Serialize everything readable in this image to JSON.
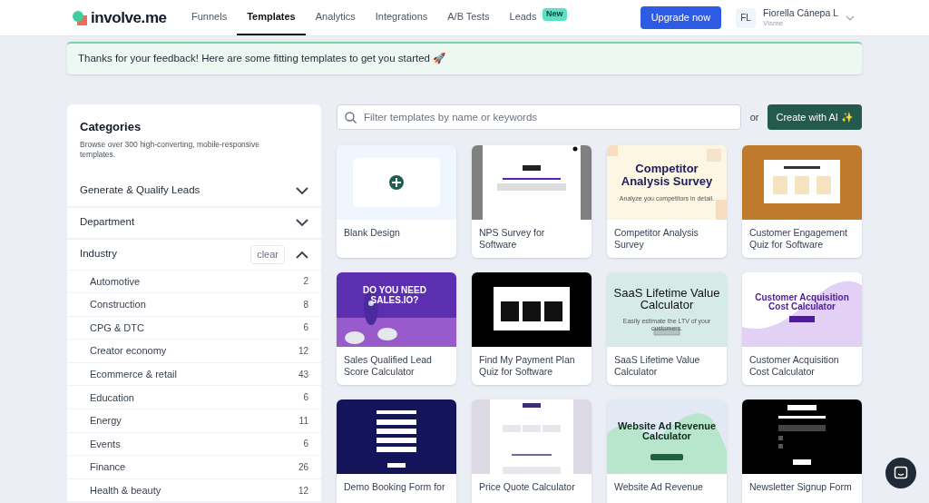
{
  "brand": "involve.me",
  "nav": [
    {
      "label": "Funnels",
      "selected": false
    },
    {
      "label": "Templates",
      "selected": true
    },
    {
      "label": "Analytics",
      "selected": false
    },
    {
      "label": "Integrations",
      "selected": false
    },
    {
      "label": "A/B Tests",
      "selected": false
    },
    {
      "label": "Leads",
      "selected": false,
      "badge": "New"
    }
  ],
  "upgrade_button": "Upgrade now",
  "user": {
    "initials": "FL",
    "name": "Fiorella Cánepa L",
    "org": "Visme"
  },
  "banner": "Thanks for your feedback! Here are some fitting templates to get you started 🚀",
  "sidebar": {
    "title": "Categories",
    "subtitle": "Browse over 300 high-converting, mobile-responsive templates.",
    "sections": [
      {
        "label": "Generate & Qualify Leads",
        "expanded": false
      },
      {
        "label": "Department",
        "expanded": false
      },
      {
        "label": "Industry",
        "expanded": true,
        "clear": "clear",
        "items": [
          {
            "label": "Automotive",
            "count": "2"
          },
          {
            "label": "Construction",
            "count": "8"
          },
          {
            "label": "CPG & DTC",
            "count": "6"
          },
          {
            "label": "Creator economy",
            "count": "12"
          },
          {
            "label": "Ecommerce & retail",
            "count": "43"
          },
          {
            "label": "Education",
            "count": "6"
          },
          {
            "label": "Energy",
            "count": "11"
          },
          {
            "label": "Events",
            "count": "6"
          },
          {
            "label": "Finance",
            "count": "26"
          },
          {
            "label": "Health & beauty",
            "count": "12"
          }
        ]
      }
    ]
  },
  "search": {
    "placeholder": "Filter templates by name or keywords"
  },
  "or": "or",
  "ai_button": "Create with AI ✨",
  "templates": [
    {
      "title": "Blank Design",
      "kind": "blank"
    },
    {
      "title": "NPS Survey for Software",
      "kind": "nps"
    },
    {
      "title": "Competitor Analysis Survey",
      "kind": "competitor",
      "heading": "Competitor Analysis Survey",
      "sub": "Analyze you competitors in detail."
    },
    {
      "title": "Customer Engagement Quiz for Software",
      "kind": "quiz"
    },
    {
      "title": "Sales Qualified Lead Score Calculator",
      "kind": "rocket",
      "heading": "DO YOU NEED SALES.IO?"
    },
    {
      "title": "Find My Payment Plan Quiz for Software",
      "kind": "payment"
    },
    {
      "title": "SaaS Lifetime Value Calculator",
      "kind": "saas",
      "heading": "SaaS Lifetime Value Calculator",
      "sub": "Easily estimate the LTV of your customers."
    },
    {
      "title": "Customer Acquisition Cost Calculator",
      "kind": "cac",
      "heading": "Customer Acquisition Cost Calculator"
    },
    {
      "title": "Demo Booking Form for",
      "kind": "demo"
    },
    {
      "title": "Price Quote Calculator",
      "kind": "price"
    },
    {
      "title": "Website Ad Revenue",
      "kind": "website",
      "heading": "Website Ad Revenue Calculator"
    },
    {
      "title": "Newsletter Signup Form",
      "kind": "newsletter"
    }
  ]
}
